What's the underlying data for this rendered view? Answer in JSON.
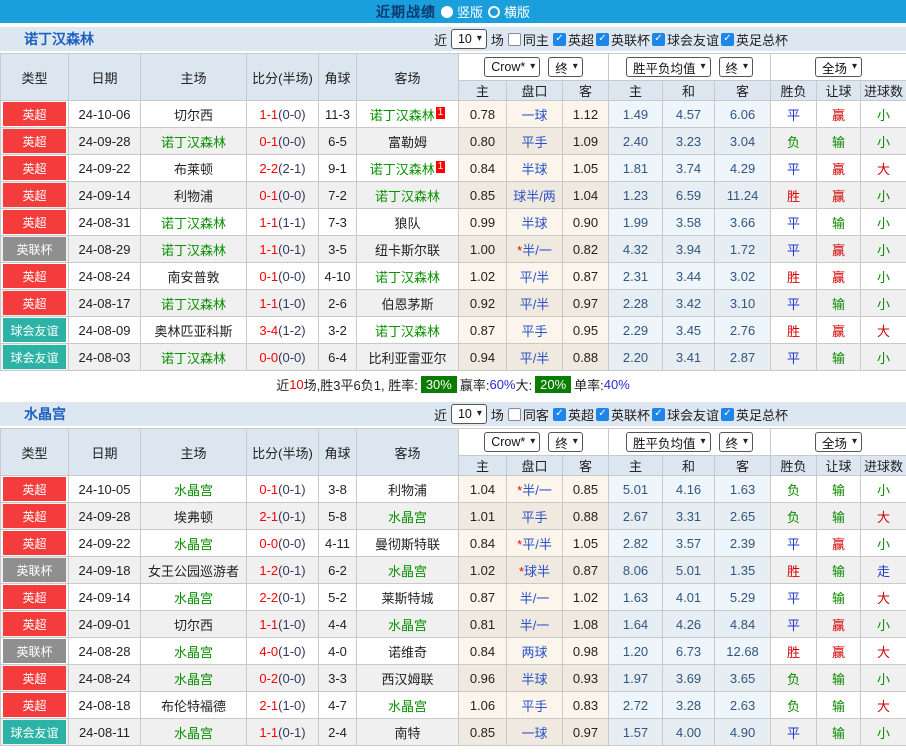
{
  "colors": {
    "titlebar_bg": "#1b9fdc",
    "title_text": "#0d3a70",
    "header_bg": "#dce6f1",
    "band_bg": "#dde7f2",
    "league_epl": "#f43c3c",
    "league_efl": "#8f8f8f",
    "league_friendly": "#2cb3a6",
    "focus_team": "#089000",
    "score": "#ff0000",
    "win": "#d40000",
    "draw": "#2038cc",
    "loss": "#0a8a00",
    "rate_badge": "#0a7d00",
    "handicap_text": "#2952c8",
    "avg_text": "#33557f",
    "checkbox_accent": "#1e86e8"
  },
  "titlebar": {
    "title": "近期战绩",
    "options": [
      {
        "label": "竖版",
        "selected": true
      },
      {
        "label": "横版",
        "selected": false
      }
    ]
  },
  "columns": {
    "main": [
      "类型",
      "日期",
      "主场",
      "比分(半场)",
      "角球",
      "客场"
    ],
    "sub": [
      "主",
      "盘口",
      "客",
      "主",
      "和",
      "客",
      "胜负",
      "让球",
      "进球数"
    ]
  },
  "dropdowns": {
    "source": "Crow*",
    "final_a": "终",
    "avg": "胜平负均值",
    "final_b": "终",
    "scope": "全场"
  },
  "sections": [
    {
      "team": "诺丁汉森林",
      "filter": {
        "recent_label": "近",
        "count": "10",
        "unit_label": "场",
        "same_label": "同主",
        "leagues": [
          "英超",
          "英联杯",
          "球会友谊",
          "英足总杯"
        ]
      },
      "rows": [
        {
          "type": "英超",
          "date": "24-10-06",
          "home": "切尔西",
          "home_focus": false,
          "home_sup": "",
          "score_ft": "1-1",
          "score_ht": "(0-0)",
          "corner": "11-3",
          "away": "诺丁汉森林",
          "away_focus": true,
          "away_sup": "1",
          "odds_home": "0.78",
          "handicap_star": "",
          "handicap": "一球",
          "odds_away": "1.12",
          "avg_home": "1.49",
          "avg_draw": "4.57",
          "avg_away": "6.06",
          "result": "平",
          "handicap_result": "赢",
          "goals_result": "小"
        },
        {
          "type": "英超",
          "date": "24-09-28",
          "home": "诺丁汉森林",
          "home_focus": true,
          "home_sup": "",
          "score_ft": "0-1",
          "score_ht": "(0-0)",
          "corner": "6-5",
          "away": "富勒姆",
          "away_focus": false,
          "away_sup": "",
          "odds_home": "0.80",
          "handicap_star": "",
          "handicap": "平手",
          "odds_away": "1.09",
          "avg_home": "2.40",
          "avg_draw": "3.23",
          "avg_away": "3.04",
          "result": "负",
          "handicap_result": "输",
          "goals_result": "小"
        },
        {
          "type": "英超",
          "date": "24-09-22",
          "home": "布莱顿",
          "home_focus": false,
          "home_sup": "",
          "score_ft": "2-2",
          "score_ht": "(2-1)",
          "corner": "9-1",
          "away": "诺丁汉森林",
          "away_focus": true,
          "away_sup": "1",
          "odds_home": "0.84",
          "handicap_star": "",
          "handicap": "半球",
          "odds_away": "1.05",
          "avg_home": "1.81",
          "avg_draw": "3.74",
          "avg_away": "4.29",
          "result": "平",
          "handicap_result": "赢",
          "goals_result": "大"
        },
        {
          "type": "英超",
          "date": "24-09-14",
          "home": "利物浦",
          "home_focus": false,
          "home_sup": "",
          "score_ft": "0-1",
          "score_ht": "(0-0)",
          "corner": "7-2",
          "away": "诺丁汉森林",
          "away_focus": true,
          "away_sup": "",
          "odds_home": "0.85",
          "handicap_star": "",
          "handicap": "球半/两",
          "odds_away": "1.04",
          "avg_home": "1.23",
          "avg_draw": "6.59",
          "avg_away": "11.24",
          "result": "胜",
          "handicap_result": "赢",
          "goals_result": "小"
        },
        {
          "type": "英超",
          "date": "24-08-31",
          "home": "诺丁汉森林",
          "home_focus": true,
          "home_sup": "",
          "score_ft": "1-1",
          "score_ht": "(1-1)",
          "corner": "7-3",
          "away": "狼队",
          "away_focus": false,
          "away_sup": "",
          "odds_home": "0.99",
          "handicap_star": "",
          "handicap": "半球",
          "odds_away": "0.90",
          "avg_home": "1.99",
          "avg_draw": "3.58",
          "avg_away": "3.66",
          "result": "平",
          "handicap_result": "输",
          "goals_result": "小"
        },
        {
          "type": "英联杯",
          "date": "24-08-29",
          "home": "诺丁汉森林",
          "home_focus": true,
          "home_sup": "",
          "score_ft": "1-1",
          "score_ht": "(0-1)",
          "corner": "3-5",
          "away": "纽卡斯尔联",
          "away_focus": false,
          "away_sup": "",
          "odds_home": "1.00",
          "handicap_star": "*",
          "handicap": "半/一",
          "odds_away": "0.82",
          "avg_home": "4.32",
          "avg_draw": "3.94",
          "avg_away": "1.72",
          "result": "平",
          "handicap_result": "赢",
          "goals_result": "小"
        },
        {
          "type": "英超",
          "date": "24-08-24",
          "home": "南安普敦",
          "home_focus": false,
          "home_sup": "",
          "score_ft": "0-1",
          "score_ht": "(0-0)",
          "corner": "4-10",
          "away": "诺丁汉森林",
          "away_focus": true,
          "away_sup": "",
          "odds_home": "1.02",
          "handicap_star": "",
          "handicap": "平/半",
          "odds_away": "0.87",
          "avg_home": "2.31",
          "avg_draw": "3.44",
          "avg_away": "3.02",
          "result": "胜",
          "handicap_result": "赢",
          "goals_result": "小"
        },
        {
          "type": "英超",
          "date": "24-08-17",
          "home": "诺丁汉森林",
          "home_focus": true,
          "home_sup": "",
          "score_ft": "1-1",
          "score_ht": "(1-0)",
          "corner": "2-6",
          "away": "伯恩茅斯",
          "away_focus": false,
          "away_sup": "",
          "odds_home": "0.92",
          "handicap_star": "",
          "handicap": "平/半",
          "odds_away": "0.97",
          "avg_home": "2.28",
          "avg_draw": "3.42",
          "avg_away": "3.10",
          "result": "平",
          "handicap_result": "输",
          "goals_result": "小"
        },
        {
          "type": "球会友谊",
          "date": "24-08-09",
          "home": "奥林匹亚科斯",
          "home_focus": false,
          "home_sup": "",
          "score_ft": "3-4",
          "score_ht": "(1-2)",
          "corner": "3-2",
          "away": "诺丁汉森林",
          "away_focus": true,
          "away_sup": "",
          "odds_home": "0.87",
          "handicap_star": "",
          "handicap": "平手",
          "odds_away": "0.95",
          "avg_home": "2.29",
          "avg_draw": "3.45",
          "avg_away": "2.76",
          "result": "胜",
          "handicap_result": "赢",
          "goals_result": "大"
        },
        {
          "type": "球会友谊",
          "date": "24-08-03",
          "home": "诺丁汉森林",
          "home_focus": true,
          "home_sup": "",
          "score_ft": "0-0",
          "score_ht": "(0-0)",
          "corner": "6-4",
          "away": "比利亚雷亚尔",
          "away_focus": false,
          "away_sup": "",
          "odds_home": "0.94",
          "handicap_star": "",
          "handicap": "平/半",
          "odds_away": "0.88",
          "avg_home": "2.20",
          "avg_draw": "3.41",
          "avg_away": "2.87",
          "result": "平",
          "handicap_result": "输",
          "goals_result": "小"
        }
      ],
      "footer": {
        "segments": [
          {
            "t": "近",
            "c": "k"
          },
          {
            "t": "10",
            "c": "r"
          },
          {
            "t": "场,胜3平6负1, 胜率:",
            "c": "k"
          },
          {
            "t": "30%",
            "c": "g"
          },
          {
            "t": "赢率:",
            "c": "k"
          },
          {
            "t": "60%",
            "c": "b"
          },
          {
            "t": " 大:",
            "c": "k"
          },
          {
            "t": "20%",
            "c": "g"
          },
          {
            "t": "单率:",
            "c": "k"
          },
          {
            "t": "40%",
            "c": "b"
          }
        ]
      }
    },
    {
      "team": "水晶宫",
      "filter": {
        "recent_label": "近",
        "count": "10",
        "unit_label": "场",
        "same_label": "同客",
        "leagues": [
          "英超",
          "英联杯",
          "球会友谊",
          "英足总杯"
        ]
      },
      "rows": [
        {
          "type": "英超",
          "date": "24-10-05",
          "home": "水晶宫",
          "home_focus": true,
          "home_sup": "",
          "score_ft": "0-1",
          "score_ht": "(0-1)",
          "corner": "3-8",
          "away": "利物浦",
          "away_focus": false,
          "away_sup": "",
          "odds_home": "1.04",
          "handicap_star": "*",
          "handicap": "半/一",
          "odds_away": "0.85",
          "avg_home": "5.01",
          "avg_draw": "4.16",
          "avg_away": "1.63",
          "result": "负",
          "handicap_result": "输",
          "goals_result": "小"
        },
        {
          "type": "英超",
          "date": "24-09-28",
          "home": "埃弗顿",
          "home_focus": false,
          "home_sup": "",
          "score_ft": "2-1",
          "score_ht": "(0-1)",
          "corner": "5-8",
          "away": "水晶宫",
          "away_focus": true,
          "away_sup": "",
          "odds_home": "1.01",
          "handicap_star": "",
          "handicap": "平手",
          "odds_away": "0.88",
          "avg_home": "2.67",
          "avg_draw": "3.31",
          "avg_away": "2.65",
          "result": "负",
          "handicap_result": "输",
          "goals_result": "大"
        },
        {
          "type": "英超",
          "date": "24-09-22",
          "home": "水晶宫",
          "home_focus": true,
          "home_sup": "",
          "score_ft": "0-0",
          "score_ht": "(0-0)",
          "corner": "4-11",
          "away": "曼彻斯特联",
          "away_focus": false,
          "away_sup": "",
          "odds_home": "0.84",
          "handicap_star": "*",
          "handicap": "平/半",
          "odds_away": "1.05",
          "avg_home": "2.82",
          "avg_draw": "3.57",
          "avg_away": "2.39",
          "result": "平",
          "handicap_result": "赢",
          "goals_result": "小"
        },
        {
          "type": "英联杯",
          "date": "24-09-18",
          "home": "女王公园巡游者",
          "home_focus": false,
          "home_sup": "",
          "score_ft": "1-2",
          "score_ht": "(0-1)",
          "corner": "6-2",
          "away": "水晶宫",
          "away_focus": true,
          "away_sup": "",
          "odds_home": "1.02",
          "handicap_star": "*",
          "handicap": "球半",
          "odds_away": "0.87",
          "avg_home": "8.06",
          "avg_draw": "5.01",
          "avg_away": "1.35",
          "result": "胜",
          "handicap_result": "输",
          "goals_result": "走"
        },
        {
          "type": "英超",
          "date": "24-09-14",
          "home": "水晶宫",
          "home_focus": true,
          "home_sup": "",
          "score_ft": "2-2",
          "score_ht": "(0-1)",
          "corner": "5-2",
          "away": "莱斯特城",
          "away_focus": false,
          "away_sup": "",
          "odds_home": "0.87",
          "handicap_star": "",
          "handicap": "半/一",
          "odds_away": "1.02",
          "avg_home": "1.63",
          "avg_draw": "4.01",
          "avg_away": "5.29",
          "result": "平",
          "handicap_result": "输",
          "goals_result": "大"
        },
        {
          "type": "英超",
          "date": "24-09-01",
          "home": "切尔西",
          "home_focus": false,
          "home_sup": "",
          "score_ft": "1-1",
          "score_ht": "(1-0)",
          "corner": "4-4",
          "away": "水晶宫",
          "away_focus": true,
          "away_sup": "",
          "odds_home": "0.81",
          "handicap_star": "",
          "handicap": "半/一",
          "odds_away": "1.08",
          "avg_home": "1.64",
          "avg_draw": "4.26",
          "avg_away": "4.84",
          "result": "平",
          "handicap_result": "赢",
          "goals_result": "小"
        },
        {
          "type": "英联杯",
          "date": "24-08-28",
          "home": "水晶宫",
          "home_focus": true,
          "home_sup": "",
          "score_ft": "4-0",
          "score_ht": "(1-0)",
          "corner": "4-0",
          "away": "诺维奇",
          "away_focus": false,
          "away_sup": "",
          "odds_home": "0.84",
          "handicap_star": "",
          "handicap": "两球",
          "odds_away": "0.98",
          "avg_home": "1.20",
          "avg_draw": "6.73",
          "avg_away": "12.68",
          "result": "胜",
          "handicap_result": "赢",
          "goals_result": "大"
        },
        {
          "type": "英超",
          "date": "24-08-24",
          "home": "水晶宫",
          "home_focus": true,
          "home_sup": "",
          "score_ft": "0-2",
          "score_ht": "(0-0)",
          "corner": "3-3",
          "away": "西汉姆联",
          "away_focus": false,
          "away_sup": "",
          "odds_home": "0.96",
          "handicap_star": "",
          "handicap": "半球",
          "odds_away": "0.93",
          "avg_home": "1.97",
          "avg_draw": "3.69",
          "avg_away": "3.65",
          "result": "负",
          "handicap_result": "输",
          "goals_result": "小"
        },
        {
          "type": "英超",
          "date": "24-08-18",
          "home": "布伦特福德",
          "home_focus": false,
          "home_sup": "",
          "score_ft": "2-1",
          "score_ht": "(1-0)",
          "corner": "4-7",
          "away": "水晶宫",
          "away_focus": true,
          "away_sup": "",
          "odds_home": "1.06",
          "handicap_star": "",
          "handicap": "平手",
          "odds_away": "0.83",
          "avg_home": "2.72",
          "avg_draw": "3.28",
          "avg_away": "2.63",
          "result": "负",
          "handicap_result": "输",
          "goals_result": "大"
        },
        {
          "type": "球会友谊",
          "date": "24-08-11",
          "home": "水晶宫",
          "home_focus": true,
          "home_sup": "",
          "score_ft": "1-1",
          "score_ht": "(0-1)",
          "corner": "2-4",
          "away": "南特",
          "away_focus": false,
          "away_sup": "",
          "odds_home": "0.85",
          "handicap_star": "",
          "handicap": "一球",
          "odds_away": "0.97",
          "avg_home": "1.57",
          "avg_draw": "4.00",
          "avg_away": "4.90",
          "result": "平",
          "handicap_result": "输",
          "goals_result": "小"
        }
      ]
    }
  ]
}
